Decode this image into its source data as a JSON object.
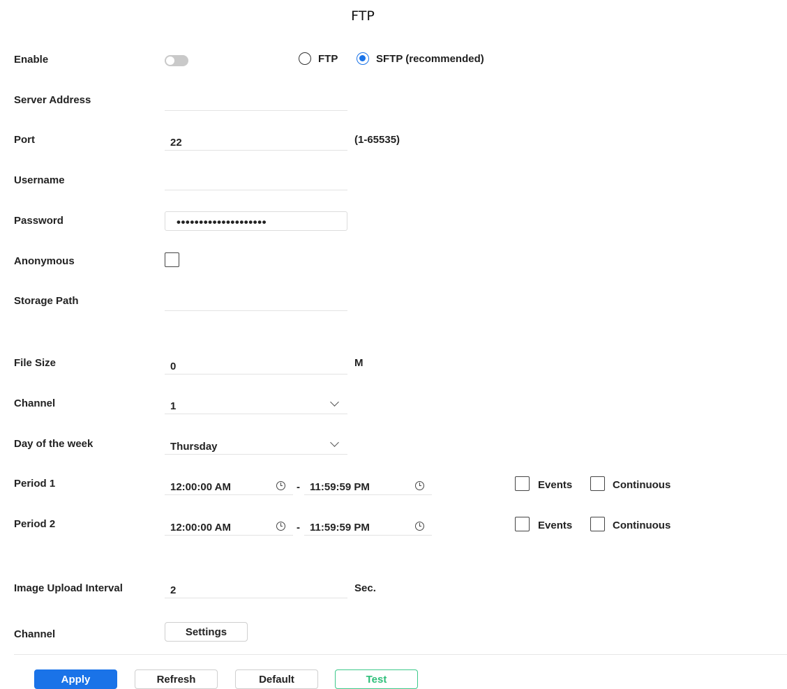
{
  "page": {
    "title": "FTP"
  },
  "enable": {
    "label": "Enable",
    "toggle_on": false
  },
  "protocol": {
    "options": [
      {
        "label": "FTP",
        "selected": false
      },
      {
        "label": "SFTP (recommended)",
        "selected": true
      }
    ]
  },
  "server_address": {
    "label": "Server Address",
    "value": ""
  },
  "port": {
    "label": "Port",
    "value": "22",
    "range": "(1-65535)"
  },
  "username": {
    "label": "Username",
    "value": ""
  },
  "password": {
    "label": "Password",
    "masked_value": "••••••••••••••••••••"
  },
  "anonymous": {
    "label": "Anonymous",
    "checked": false
  },
  "storage_path": {
    "label": "Storage Path",
    "value": ""
  },
  "file_size": {
    "label": "File Size",
    "value": "0",
    "unit": "M"
  },
  "channel_select": {
    "label": "Channel",
    "value": "1"
  },
  "day_of_week": {
    "label": "Day of the week",
    "value": "Thursday"
  },
  "periods": [
    {
      "label": "Period 1",
      "start": "12:00:00 AM",
      "end": "11:59:59 PM",
      "separator": "-",
      "events_label": "Events",
      "continuous_label": "Continuous"
    },
    {
      "label": "Period 2",
      "start": "12:00:00 AM",
      "end": "11:59:59 PM",
      "separator": "-",
      "events_label": "Events",
      "continuous_label": "Continuous"
    }
  ],
  "image_upload_interval": {
    "label": "Image Upload Interval",
    "value": "2",
    "unit": "Sec."
  },
  "channel_settings": {
    "label": "Channel",
    "button": "Settings"
  },
  "footer": {
    "apply": "Apply",
    "refresh": "Refresh",
    "default": "Default",
    "test": "Test"
  },
  "colors": {
    "primary": "#1a73e8",
    "test": "#2fbf7a"
  },
  "icons": {
    "dropdown": "chevron-down-icon",
    "time": "clock-icon"
  }
}
